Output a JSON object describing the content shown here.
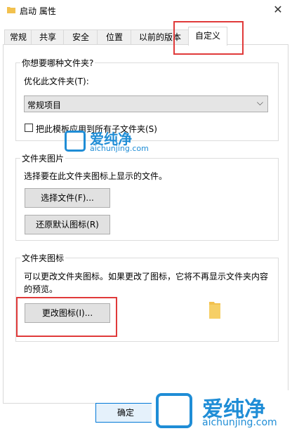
{
  "window": {
    "title": "启动 属性",
    "close_glyph": "✕"
  },
  "tabs": [
    "常规",
    "共享",
    "安全",
    "位置",
    "以前的版本",
    "自定义"
  ],
  "customize": {
    "folder_type_group": "你想要哪种文件夹?",
    "optimize_label": "优化此文件夹(T):",
    "optimize_value": "常规项目",
    "apply_template_label": "把此模板应用到所有子文件夹(S)"
  },
  "folder_pictures": {
    "group_title": "文件夹图片",
    "description": "选择要在此文件夹图标上显示的文件。",
    "choose_file_button": "选择文件(F)...",
    "restore_default_button": "还原默认图标(R)"
  },
  "folder_icons": {
    "group_title": "文件夹图标",
    "description_line1": "可以更改文件夹图标。如果更改了图标，它将不再显示文件夹内容",
    "description_line2": "的预览。",
    "change_icon_button": "更改图标(I)..."
  },
  "footer": {
    "ok_button": "确定"
  },
  "watermark": {
    "name": "爱纯净",
    "url": "aichunjing.com"
  },
  "colors": {
    "highlight": "#e03a3a",
    "watermark": "#1f8dd6",
    "folder": "#f2c14e"
  },
  "icons": {
    "title": "folder-icon",
    "preview": "folder-icon"
  }
}
